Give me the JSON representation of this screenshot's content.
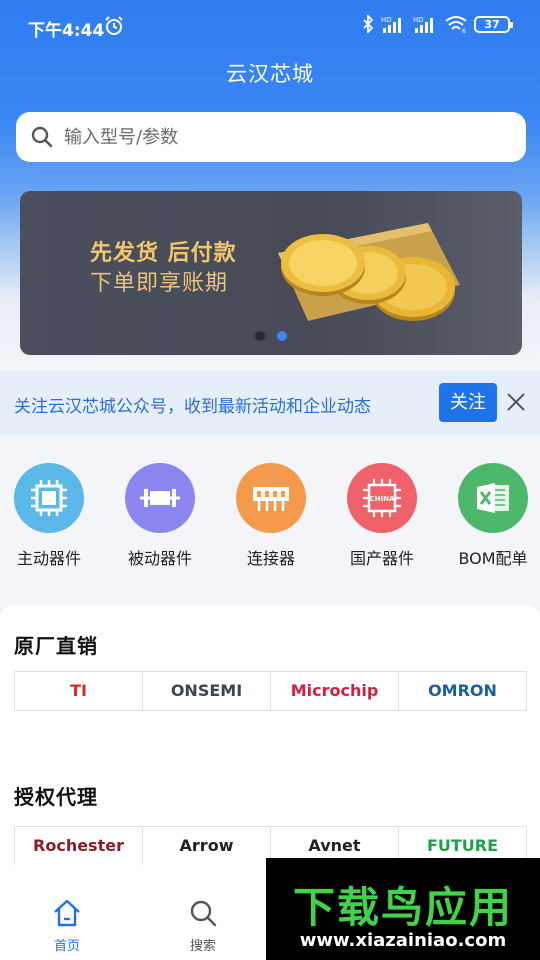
{
  "status_bar": {
    "time": "下午4:44",
    "battery": "37",
    "signal_tag_1": "HD",
    "signal_tag_2": "HD",
    "wifi_sub": "6"
  },
  "app": {
    "title": "云汉芯城"
  },
  "search": {
    "placeholder": "输入型号/参数"
  },
  "banner": {
    "line1": "先发货 后付款",
    "line2": "下单即享账期",
    "active_dot_index": 1,
    "dot_count": 2
  },
  "notice": {
    "text": "关注云汉芯城公众号，收到最新活动和企业动态",
    "follow_label": "关注"
  },
  "categories": [
    {
      "label": "主动器件",
      "icon": "chip-icon",
      "color": "#5bb8e8"
    },
    {
      "label": "被动器件",
      "icon": "resistor-icon",
      "color": "#8c86f0"
    },
    {
      "label": "连接器",
      "icon": "connector-icon",
      "color": "#f39a4c"
    },
    {
      "label": "国产器件",
      "icon": "china-chip-icon",
      "color": "#f0626a"
    },
    {
      "label": "BOM配单",
      "icon": "excel-icon",
      "color": "#4cb96a"
    }
  ],
  "direct_sales": {
    "title": "原厂直销",
    "brands": [
      {
        "name": "TI",
        "color": "#d42a2a"
      },
      {
        "name": "ONSEMI",
        "color": "#3b4650"
      },
      {
        "name": "Microchip",
        "color": "#d21f3c"
      },
      {
        "name": "OMRON",
        "color": "#1d5e9e"
      }
    ]
  },
  "authorized": {
    "title": "授权代理",
    "brands": [
      {
        "name": "Rochester",
        "color": "#8b1e2a"
      },
      {
        "name": "Arrow",
        "color": "#222222"
      },
      {
        "name": "Avnet",
        "color": "#222222"
      },
      {
        "name": "FUTURE",
        "color": "#1fa04a"
      }
    ]
  },
  "tabbar": [
    {
      "label": "首页",
      "icon": "home-icon",
      "active": true
    },
    {
      "label": "搜索",
      "icon": "search-icon",
      "active": false
    }
  ],
  "watermark": {
    "title": "下载鸟应用",
    "url": "www.xiazainiao.com"
  },
  "colors": {
    "primary": "#1f73e8",
    "active_tab": "#1f73e8",
    "inactive_tab": "#555555"
  }
}
